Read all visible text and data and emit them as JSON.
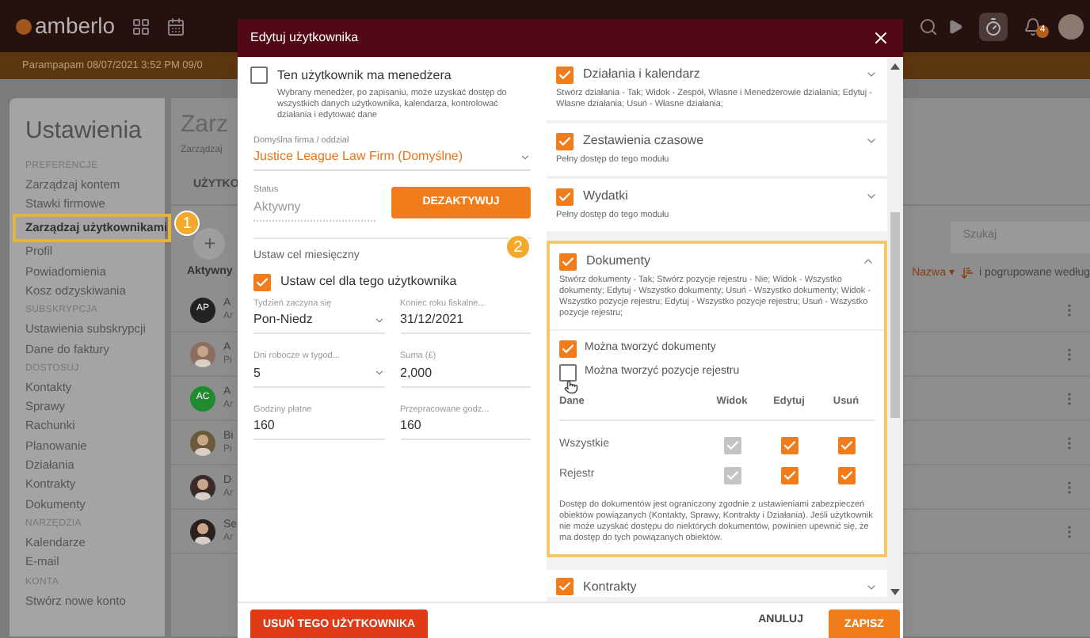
{
  "app": {
    "logo": "amberlo",
    "banner": "Parampapam 08/07/2021 3:52 PM 09/0",
    "notifications": "4"
  },
  "sidebar": {
    "title": "Ustawienia",
    "sections": [
      {
        "heading": "PREFERENCJE",
        "items": [
          {
            "label": "Zarządzaj kontem",
            "selected": false
          },
          {
            "label": "Stawki firmowe",
            "selected": false
          },
          {
            "label": "Zarządzaj użytkownikami",
            "selected": true,
            "callout": "1"
          },
          {
            "label": "Profil",
            "selected": false
          },
          {
            "label": "Powiadomienia",
            "selected": false
          },
          {
            "label": "Kosz odzyskiwania",
            "selected": false
          }
        ]
      },
      {
        "heading": "SUBSKRYPCJA",
        "items": [
          {
            "label": "Ustawienia subskrypcji",
            "selected": false
          },
          {
            "label": "Dane do faktury",
            "selected": false
          }
        ]
      },
      {
        "heading": "DOSTOSUJ",
        "items": [
          {
            "label": "Kontakty",
            "selected": false
          },
          {
            "label": "Sprawy",
            "selected": false
          },
          {
            "label": "Rachunki",
            "selected": false
          },
          {
            "label": "Planowanie",
            "selected": false
          },
          {
            "label": "Działania",
            "selected": false
          },
          {
            "label": "Kontrakty",
            "selected": false
          },
          {
            "label": "Dokumenty",
            "selected": false
          }
        ]
      },
      {
        "heading": "NARZĘDZIA",
        "items": [
          {
            "label": "Kalendarze",
            "selected": false
          },
          {
            "label": "E-mail",
            "selected": false
          }
        ]
      },
      {
        "heading": "KONTA",
        "items": [
          {
            "label": "Stwórz nowe konto",
            "selected": false
          }
        ]
      }
    ]
  },
  "main": {
    "title": "Zarz",
    "subtitle": "Zarządzaj",
    "tab": "UŻYTKO",
    "add": "+",
    "filter": "Aktywny",
    "search": {
      "placeholder": "Szukaj"
    },
    "sort": "Nazwa ▾",
    "group": "i pogrupowane według",
    "rows": [
      {
        "avatar": "AP",
        "photo": false,
        "color": "#222222",
        "name": "A",
        "sub": "Ar"
      },
      {
        "avatar": "",
        "photo": true,
        "color": "#8a7060",
        "name": "A",
        "sub": "Pi"
      },
      {
        "avatar": "AC",
        "photo": false,
        "color": "#1f8a2e",
        "name": "A",
        "sub": "Ar"
      },
      {
        "avatar": "",
        "photo": true,
        "color": "#6a5a3a",
        "name": "Bi",
        "sub": "Pi"
      },
      {
        "avatar": "",
        "photo": true,
        "color": "#3a2a2a",
        "name": "D",
        "sub": "Ar"
      },
      {
        "avatar": "",
        "photo": true,
        "color": "#2a2020",
        "name": "Se",
        "sub": "Ar"
      }
    ]
  },
  "dialog": {
    "title": "Edytuj użytkownika",
    "manager": {
      "label": "Ten użytkownik ma menedżera",
      "checked": false,
      "hint": "Wybrany menedżer, po zapisaniu, może uzyskać dostęp do wszystkich danych użytkownika, kalendarza, kontrolować działania i edytować dane"
    },
    "firm": {
      "label": "Domyślna firma / oddział",
      "value": "Justice League Law Firm (Domyślne)"
    },
    "status": {
      "label": "Status",
      "value": "Aktywny",
      "button": "DEZAKTYWUJ"
    },
    "goal": {
      "heading": "Ustaw cel miesięczny",
      "label": "Ustaw cel dla tego użytkownika",
      "checked": true,
      "fields": [
        {
          "label": "Tydzień zaczyna się",
          "value": "Pon-Niedz",
          "kind": "select"
        },
        {
          "label": "Koniec roku fiskalne...",
          "value": "31/12/2021",
          "kind": "text"
        },
        {
          "label": "Dni robocze w tygod...",
          "value": "5",
          "kind": "select"
        },
        {
          "label": "Suma (£)",
          "value": "2,000",
          "kind": "text"
        },
        {
          "label": "Godziny płatne",
          "value": "160",
          "kind": "text"
        },
        {
          "label": "Przepracowane godz...",
          "value": "160",
          "kind": "text"
        }
      ]
    },
    "modules": [
      {
        "title": "Działania i kalendarz",
        "checked": true,
        "expanded": false,
        "summary": "Stwórz działania - Tak; Widok - Zespół, Własne i Menedżerowie działania; Edytuj - Własne działania; Usuń - Własne działania;"
      },
      {
        "title": "Zestawienia czasowe",
        "checked": true,
        "expanded": false,
        "summary": "Pełny dostęp do tego modułu"
      },
      {
        "title": "Wydatki",
        "checked": true,
        "expanded": false,
        "summary": "Pełny dostęp do tego modułu"
      },
      {
        "title": "Dokumenty",
        "checked": true,
        "expanded": true,
        "callout": "2",
        "summary": "Stwórz dokumenty - Tak; Stwórz pozycje rejestru - Nie; Widok - Wszystko dokumenty; Edytuj - Wszystko dokumenty; Usuń - Wszystko dokumenty; Widok - Wszystko pozycje rejestru; Edytuj - Wszystko pozycje rejestru; Usuń - Wszystko pozycje rejestru;",
        "options": [
          {
            "label": "Można tworzyć dokumenty",
            "checked": true
          },
          {
            "label": "Można tworzyć pozycje rejestru",
            "checked": false
          }
        ],
        "table": {
          "columns": [
            "Dane",
            "Widok",
            "Edytuj",
            "Usuń"
          ],
          "rows": [
            {
              "label": "Wszystkie",
              "cells": [
                {
                  "checked": true,
                  "disabled": true
                },
                {
                  "checked": true,
                  "disabled": false
                },
                {
                  "checked": true,
                  "disabled": false
                }
              ]
            },
            {
              "label": "Rejestr",
              "cells": [
                {
                  "checked": true,
                  "disabled": true
                },
                {
                  "checked": true,
                  "disabled": false
                },
                {
                  "checked": true,
                  "disabled": false
                }
              ]
            }
          ]
        },
        "note": "Dostęp do dokumentów jest ograniczony zgodnie z ustawieniami zabezpieczeń obiektów powiązanych (Kontakty, Sprawy, Kontrakty i Działania). Jeśli użytkownik nie może uzyskać dostępu do niektórych dokumentów, powinien upewnić się, że ma dostęp do tych powiązanych obiektów."
      },
      {
        "title": "Kontrakty",
        "checked": true,
        "expanded": false
      }
    ],
    "delete": "USUŃ TEGO UŻYTKOWNIKA",
    "cancel": "ANULUJ",
    "save": "ZAPISZ"
  }
}
